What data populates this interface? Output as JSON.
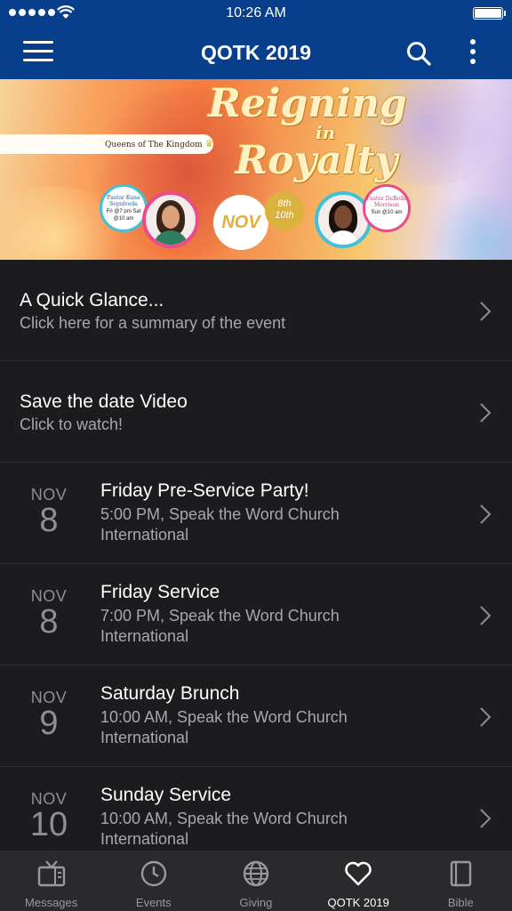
{
  "status_bar": {
    "time": "10:26 AM"
  },
  "nav": {
    "title": "QOTK 2019"
  },
  "banner": {
    "ribbon_text": "Queens of The Kingdom",
    "title_line1": "Reigning",
    "title_line2": "in",
    "title_line3": "Royalty",
    "pastor_left_name": "Pastor Kuna Sepulveda",
    "pastor_left_times": "Fri @7 pm Sat @10 am",
    "pastor_right_name": "Pastor DeBelle Morrison",
    "pastor_right_times": "Sun @10 am",
    "month": "NOV",
    "dates_line1": "8th",
    "dates_line2": "10th"
  },
  "list": {
    "simple_items": [
      {
        "title": "A Quick Glance...",
        "subtitle": "Click here for a summary of the event"
      },
      {
        "title": "Save the date Video",
        "subtitle": "Click to watch!"
      }
    ],
    "events": [
      {
        "month": "NOV",
        "day": "8",
        "title": "Friday Pre-Service Party!",
        "subtitle": "5:00 PM, Speak the Word Church International"
      },
      {
        "month": "NOV",
        "day": "8",
        "title": "Friday Service",
        "subtitle": "7:00 PM, Speak the Word Church International"
      },
      {
        "month": "NOV",
        "day": "9",
        "title": "Saturday Brunch",
        "subtitle": "10:00 AM, Speak the Word Church International"
      },
      {
        "month": "NOV",
        "day": "10",
        "title": "Sunday Service",
        "subtitle": "10:00 AM, Speak the Word Church International"
      }
    ]
  },
  "tabs": [
    {
      "label": "Messages",
      "icon": "tv-icon"
    },
    {
      "label": "Events",
      "icon": "clock-icon"
    },
    {
      "label": "Giving",
      "icon": "globe-icon"
    },
    {
      "label": "QOTK 2019",
      "icon": "heart-icon",
      "active": true
    },
    {
      "label": "Bible",
      "icon": "book-icon"
    }
  ],
  "colors": {
    "nav_background": "#073f8c",
    "list_background": "#1c1c1e",
    "tabbar_background": "#2a2a2c"
  }
}
